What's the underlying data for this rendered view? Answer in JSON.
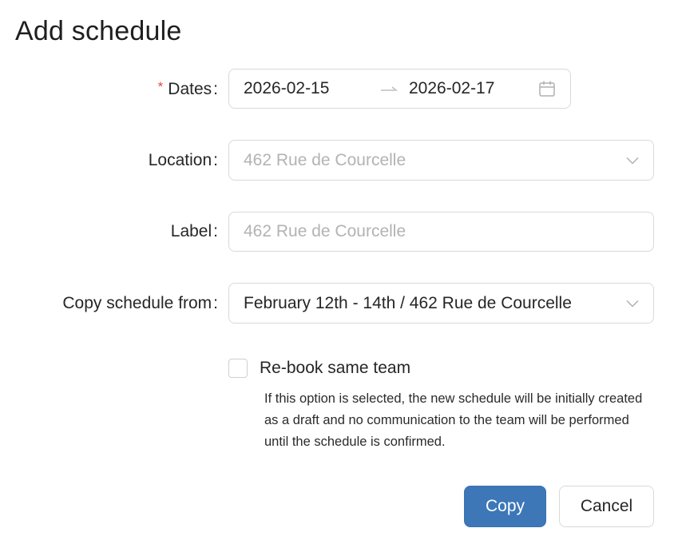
{
  "modal": {
    "title": "Add schedule"
  },
  "form": {
    "dates": {
      "label": "Dates",
      "required": "*",
      "start": "2026-02-15",
      "end": "2026-02-17"
    },
    "location": {
      "label": "Location",
      "placeholder": "462 Rue de Courcelle"
    },
    "label_field": {
      "label": "Label",
      "placeholder": "462 Rue de Courcelle"
    },
    "copy_from": {
      "label": "Copy schedule from",
      "value": "February 12th - 14th / 462 Rue de Courcelle"
    },
    "rebook": {
      "label": "Re-book same team",
      "checked": false,
      "help": "If this option is selected, the new schedule will be initially created as a draft and no communication to the team will be performed until the schedule is confirmed."
    },
    "colon": ":"
  },
  "actions": {
    "copy_label": "Copy",
    "cancel_label": "Cancel"
  },
  "icons": {
    "dates": "calendar-icon",
    "range_separator": "arrow-right-icon",
    "select": "chevron-down-icon"
  },
  "colors": {
    "primary": "#3d77b8",
    "required": "#e8473c",
    "border": "#d9d9d9",
    "placeholder": "#b3b3b3"
  }
}
